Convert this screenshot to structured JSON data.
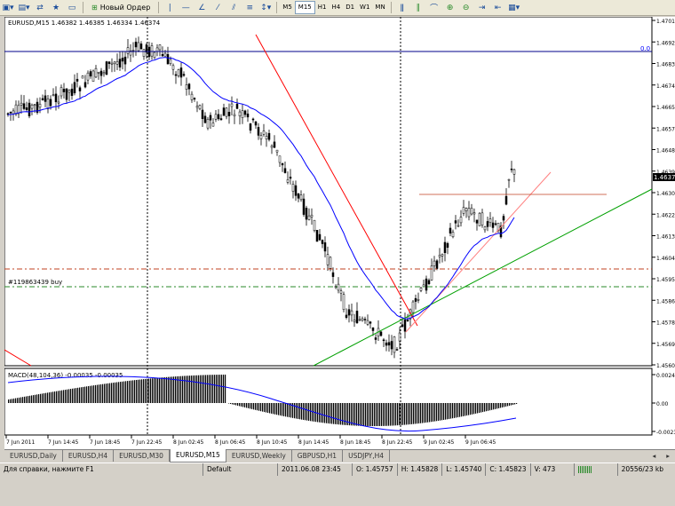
{
  "toolbar": {
    "new_order_label": "Новый Ордер",
    "timeframes": [
      "M5",
      "M15",
      "H1",
      "H4",
      "D1",
      "W1",
      "MN"
    ],
    "active_timeframe": "M15"
  },
  "chart": {
    "header": "EURUSD,M15  1.46382 1.46385 1.46334 1.46374",
    "price_ticks": [
      "1.4701",
      "1.4692",
      "1.4683",
      "1.4674",
      "1.4665",
      "1.4657",
      "1.4648",
      "1.4639",
      "1.4630",
      "1.4622",
      "1.4613",
      "1.4604",
      "1.4595",
      "1.4586",
      "1.4578",
      "1.4569",
      "1.4560"
    ],
    "current_price": "1.4637",
    "level_label": "0.0",
    "order_label": "#119863439 buy",
    "macd_label": "MACD(48,104,36) -0.00035 -0.00035",
    "macd_ticks": [
      "0.0024",
      "0.00",
      "-0.0023"
    ],
    "time_ticks": [
      "7 Jun 2011",
      "7 Jun 14:45",
      "7 Jun 18:45",
      "7 Jun 22:45",
      "8 Jun 02:45",
      "8 Jun 06:45",
      "8 Jun 10:45",
      "8 Jun 14:45",
      "8 Jun 18:45",
      "8 Jun 22:45",
      "9 Jun 02:45",
      "9 Jun 06:45"
    ]
  },
  "tabs": [
    "EURUSD,Daily",
    "EURUSD,H4",
    "EURUSD,M30",
    "EURUSD,M15",
    "EURUSD,Weekly",
    "GBPUSD,H1",
    "USDJPY,H4"
  ],
  "active_tab": "EURUSD,M15",
  "status": {
    "help": "Для справки, нажмите F1",
    "profile": "Default",
    "datetime": "2011.06.08 23:45",
    "open": "O: 1.45757",
    "high": "H: 1.45828",
    "low": "L: 1.45740",
    "close": "C: 1.45823",
    "volume": "V: 473",
    "traffic": "20556/23 kb"
  },
  "colors": {
    "up_candle": "#000000",
    "ma_line": "#0000ff",
    "trend_red": "#ff0000",
    "trend_green": "#00a000",
    "macd_signal": "#0000ff"
  }
}
